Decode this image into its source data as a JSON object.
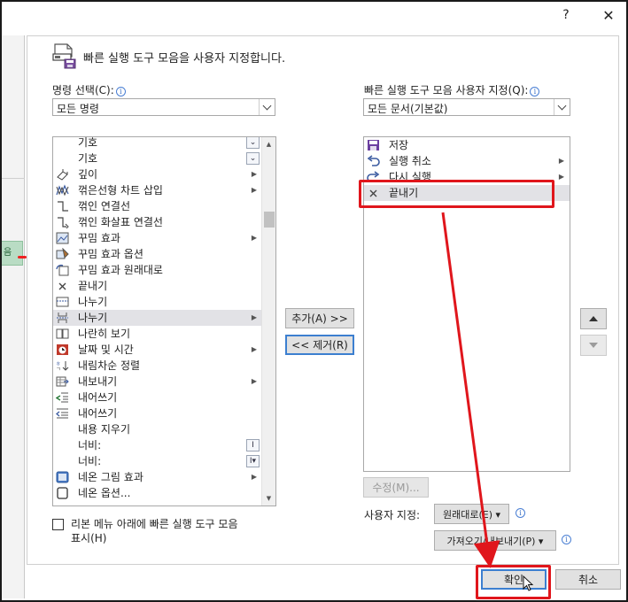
{
  "window": {
    "help_label": "?",
    "close_label": "✕"
  },
  "left_pane": {
    "tab_label": "음"
  },
  "header": {
    "title": "빠른 실행 도구 모음을 사용자 지정합니다.",
    "icon": "quick-access-toolbar-icon"
  },
  "left_column": {
    "label": "명령 선택(C):",
    "dropdown_value": "모든 명령",
    "items": [
      {
        "label": "기호",
        "icon": "none",
        "extra": "scroll-btn"
      },
      {
        "label": "기호",
        "icon": "none",
        "extra": "scroll-btn"
      },
      {
        "label": "깊이",
        "icon": "depth-icon",
        "extra": "arrow"
      },
      {
        "label": "꺾은선형 차트 삽입",
        "icon": "line-chart-icon",
        "extra": "arrow"
      },
      {
        "label": "꺾인 연결선",
        "icon": "elbow-connector-icon",
        "extra": ""
      },
      {
        "label": "꺾인 화살표 연결선",
        "icon": "elbow-arrow-connector-icon",
        "extra": ""
      },
      {
        "label": "꾸밈 효과",
        "icon": "artistic-effects-icon",
        "extra": "arrow"
      },
      {
        "label": "꾸밈 효과 옵션",
        "icon": "artistic-options-icon",
        "extra": ""
      },
      {
        "label": "꾸밈 효과 원래대로",
        "icon": "reset-effects-icon",
        "extra": ""
      },
      {
        "label": "끝내기",
        "icon": "close-x-icon",
        "extra": ""
      },
      {
        "label": "나누기",
        "icon": "split-icon",
        "extra": ""
      },
      {
        "label": "나누기",
        "icon": "break-icon",
        "extra": "arrow"
      },
      {
        "label": "나란히 보기",
        "icon": "side-by-side-icon",
        "extra": ""
      },
      {
        "label": "날짜 및 시간",
        "icon": "date-time-icon",
        "extra": "arrow"
      },
      {
        "label": "내림차순 정렬",
        "icon": "sort-desc-icon",
        "extra": ""
      },
      {
        "label": "내보내기",
        "icon": "export-icon",
        "extra": "arrow"
      },
      {
        "label": "내어쓰기",
        "icon": "outdent-icon",
        "extra": ""
      },
      {
        "label": "내어쓰기",
        "icon": "outdent-left-icon",
        "extra": ""
      },
      {
        "label": "내용 지우기",
        "icon": "none",
        "extra": ""
      },
      {
        "label": "너비:",
        "icon": "none",
        "extra": "text-btn"
      },
      {
        "label": "너비:",
        "icon": "none",
        "extra": "text-dropdown-btn"
      },
      {
        "label": "네온 그림 효과",
        "icon": "glow-icon",
        "extra": "arrow"
      },
      {
        "label": "네온 옵션...",
        "icon": "glow-options-icon",
        "extra": ""
      }
    ],
    "selected_index": 11,
    "show_below_label_line1": "리본 메뉴 아래에 빠른 실행 도구 모음",
    "show_below_label_line2": "표시(H)"
  },
  "middle": {
    "add_label": "추가(A) >>",
    "remove_label": "<< 제거(R)"
  },
  "right_column": {
    "label": "빠른 실행 도구 모음 사용자 지정(Q):",
    "dropdown_value": "모든 문서(기본값)",
    "items": [
      {
        "label": "저장",
        "icon": "save-icon",
        "extra": ""
      },
      {
        "label": "실행 취소",
        "icon": "undo-icon",
        "extra": "arrow"
      },
      {
        "label": "다시 실행",
        "icon": "redo-icon",
        "extra": "arrow"
      },
      {
        "label": "끝내기",
        "icon": "close-x-icon",
        "extra": ""
      }
    ],
    "selected_index": 3,
    "modify_label": "수정(M)...",
    "customize_label": "사용자 지정:",
    "reset_label": "원래대로(E) ▾",
    "import_export_label": "가져오기/내보내기(P) ▾"
  },
  "footer": {
    "ok_label": "확인",
    "cancel_label": "취소"
  },
  "colors": {
    "annotation_red": "#e0161c",
    "focus_blue": "#3c7fd0",
    "selection_gray": "#e2e2e6"
  }
}
